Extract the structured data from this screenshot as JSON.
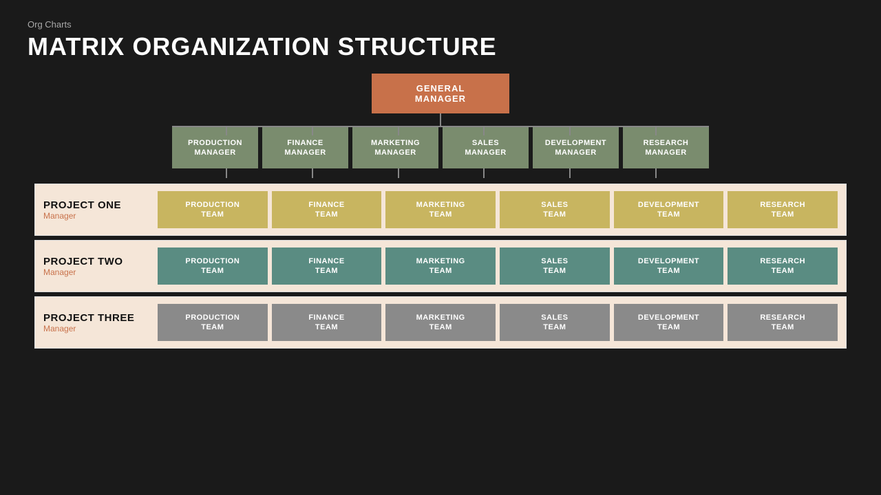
{
  "header": {
    "subtitle": "Org Charts",
    "title": "MATRIX ORGANIZATION STRUCTURE"
  },
  "gm": {
    "label": "GENERAL MANAGER"
  },
  "managers": [
    {
      "label": "PRODUCTION\nMANAGER"
    },
    {
      "label": "FINANCE\nMANAGER"
    },
    {
      "label": "MARKETING\nMANAGER"
    },
    {
      "label": "SALES\nMANAGER"
    },
    {
      "label": "DEVELOPMENT\nMANAGER"
    },
    {
      "label": "RESEARCH\nMANAGER"
    }
  ],
  "projects": [
    {
      "name": "PROJECT ONE",
      "manager_label": "Manager",
      "row_class": "row1",
      "teams": [
        "PRODUCTION\nTEAM",
        "FINANCE\nTEAM",
        "MARKETING\nTEAM",
        "SALES\nTEAM",
        "DEVELOPMENT\nTEAM",
        "RESEARCH\nTEAM"
      ]
    },
    {
      "name": "PROJECT TWO",
      "manager_label": "Manager",
      "row_class": "row2",
      "teams": [
        "PRODUCTION\nTEAM",
        "FINANCE\nTEAM",
        "MARKETING\nTEAM",
        "SALES\nTEAM",
        "DEVELOPMENT\nTEAM",
        "RESEARCH\nTEAM"
      ]
    },
    {
      "name": "PROJECT THREE",
      "manager_label": "Manager",
      "row_class": "row3",
      "teams": [
        "PRODUCTION\nTEAM",
        "FINANCE\nTEAM",
        "MARKETING\nTEAM",
        "SALES\nTEAM",
        "DEVELOPMENT\nTEAM",
        "RESEARCH\nTEAM"
      ]
    }
  ]
}
